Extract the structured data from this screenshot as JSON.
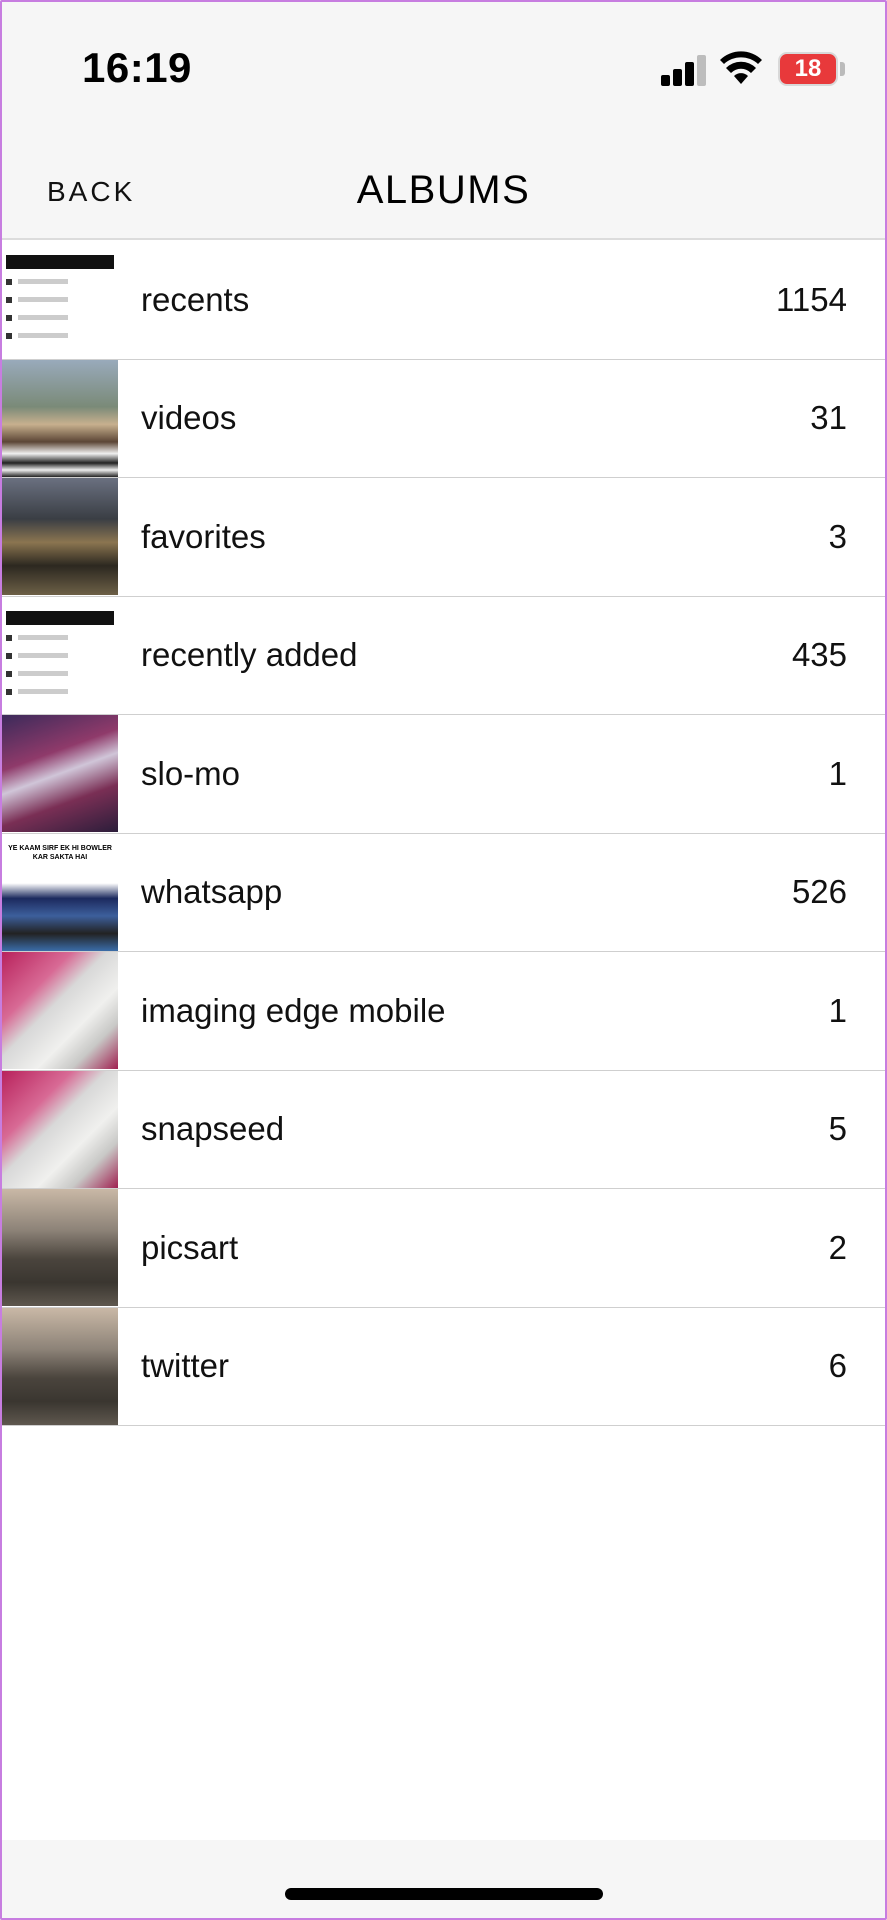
{
  "status_bar": {
    "time": "16:19",
    "battery": "18",
    "battery_color": "#e8393b"
  },
  "nav": {
    "back_label": "BACK",
    "title": "ALBUMS"
  },
  "albums": [
    {
      "name": "recents",
      "count": "1154",
      "thumb": "document-screenshot"
    },
    {
      "name": "videos",
      "count": "31",
      "thumb": "selfie"
    },
    {
      "name": "favorites",
      "count": "3",
      "thumb": "statue"
    },
    {
      "name": "recently added",
      "count": "435",
      "thumb": "document-screenshot"
    },
    {
      "name": "slo-mo",
      "count": "1",
      "thumb": "circus"
    },
    {
      "name": "whatsapp",
      "count": "526",
      "thumb": "cricket",
      "thumb_caption": "YE KAAM SIRF EK HI BOWLER KAR SAKTA HAI"
    },
    {
      "name": "imaging edge mobile",
      "count": "1",
      "thumb": "phone"
    },
    {
      "name": "snapseed",
      "count": "5",
      "thumb": "phone"
    },
    {
      "name": "picsart",
      "count": "2",
      "thumb": "blurred"
    },
    {
      "name": "twitter",
      "count": "6",
      "thumb": "blurred"
    }
  ],
  "icons": [
    "cellular-signal-icon",
    "wifi-icon",
    "battery-charging-icon"
  ]
}
